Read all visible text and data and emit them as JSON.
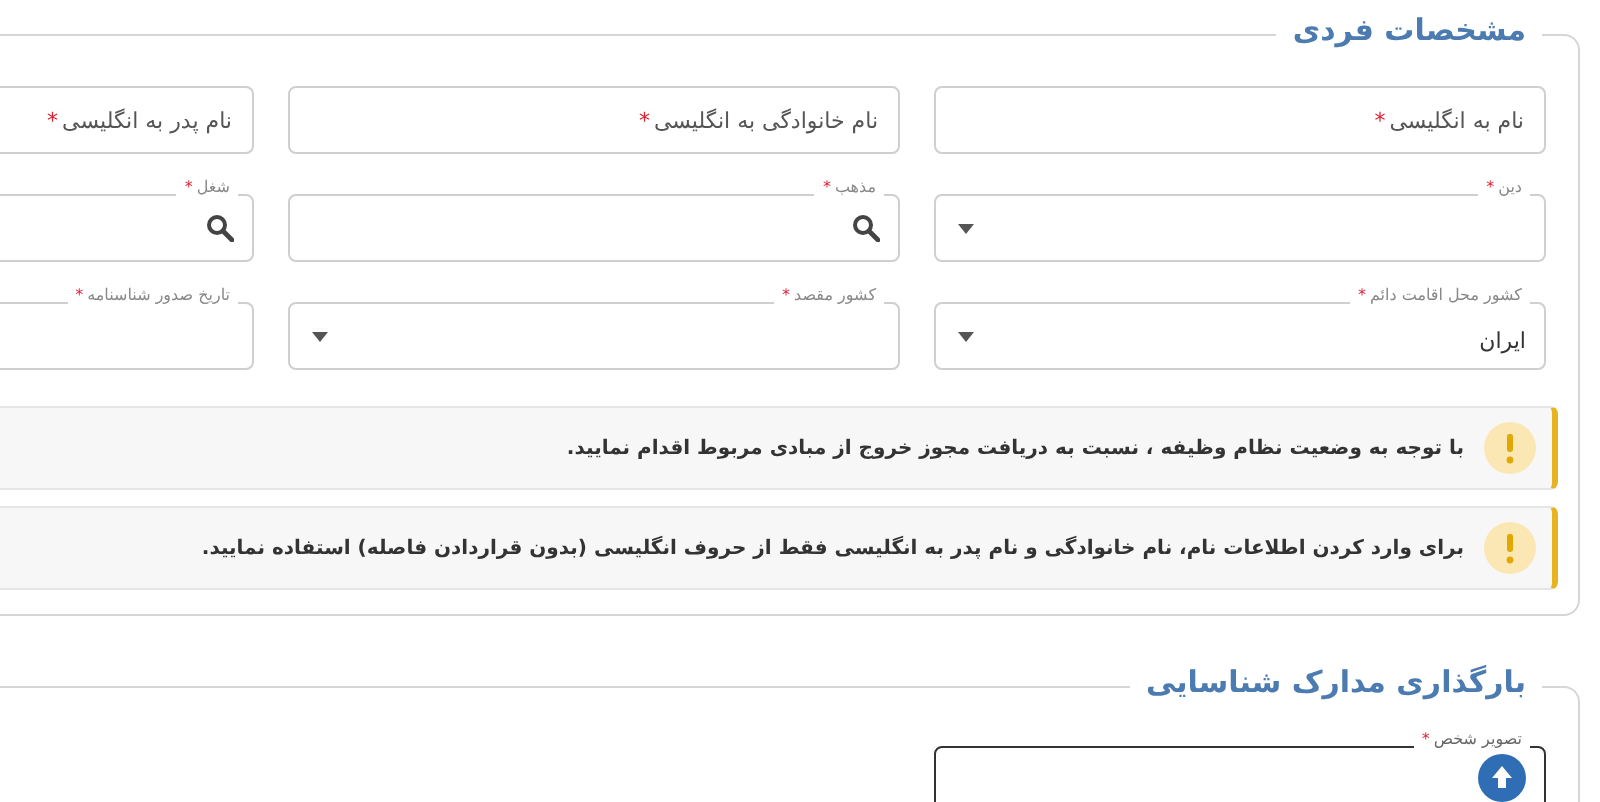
{
  "personal_section": {
    "title": "مشخصات فردی",
    "fields": [
      {
        "label": "نام به انگلیسی",
        "required_mark": "*",
        "kind": "text"
      },
      {
        "label": "نام خانوادگی به انگلیسی",
        "required_mark": "*",
        "kind": "text"
      },
      {
        "label": "نام پدر به انگلیسی",
        "required_mark": "*",
        "kind": "text"
      },
      {
        "label": "دین",
        "required_mark": "*",
        "kind": "select"
      },
      {
        "label": "مذهب",
        "required_mark": "*",
        "kind": "search"
      },
      {
        "label": "شغل",
        "required_mark": "*",
        "kind": "search"
      },
      {
        "label": "کشور محل اقامت دائم",
        "required_mark": "*",
        "kind": "select",
        "value": "ایران"
      },
      {
        "label": "کشور مقصد",
        "required_mark": "*",
        "kind": "select"
      },
      {
        "label": "تاریخ صدور شناسنامه",
        "required_mark": "*",
        "kind": "date"
      }
    ],
    "alerts": [
      {
        "text": "با توجه به وضعیت نظام وظیفه ، نسبت به دریافت مجوز خروج از مبادی مربوط اقدام نمایید."
      },
      {
        "text": "برای وارد کردن اطلاعات نام، نام خانوادگی و نام پدر به انگلیسی فقط از حروف انگلیسی (بدون قراردادن فاصله) استفاده نمایید."
      }
    ]
  },
  "documents_section": {
    "title": "بارگذاری مدارک شناسایی",
    "fields": [
      {
        "label": "تصویر شخص",
        "required_mark": "*",
        "kind": "upload"
      }
    ]
  }
}
